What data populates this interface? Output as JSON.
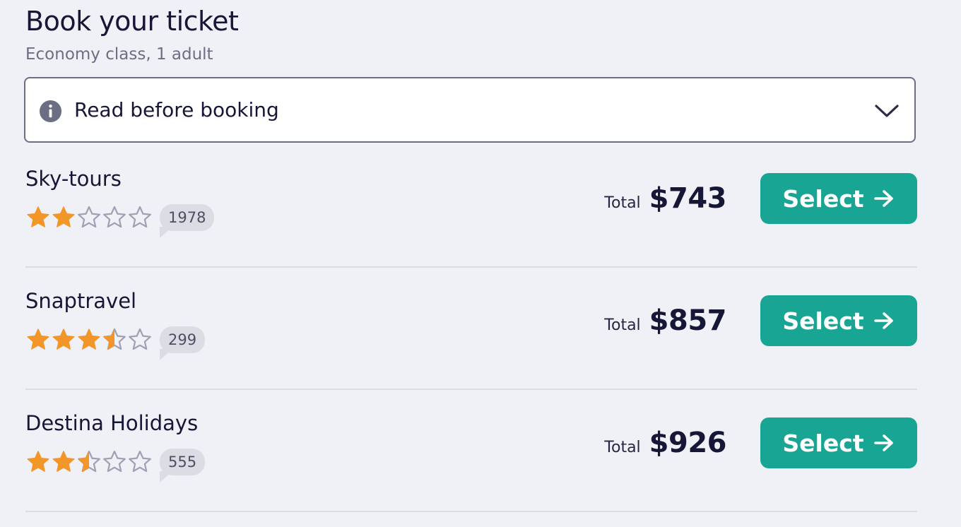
{
  "page": {
    "title": "Book your ticket",
    "subtitle": "Economy class, 1 adult"
  },
  "notice": {
    "label": "Read before booking",
    "icon": "info-icon",
    "toggle_icon": "chevron-down-icon"
  },
  "colors": {
    "accent": "#19a593",
    "star_filled": "#f39629",
    "star_empty": "#9ea1b3",
    "text_primary": "#161637",
    "background": "#f0f1f6"
  },
  "offers": [
    {
      "agency": "Sky-tours",
      "rating": 2,
      "review_count": "1978",
      "total_label": "Total",
      "price": "$743",
      "select_label": "Select"
    },
    {
      "agency": "Snaptravel",
      "rating": 3.5,
      "review_count": "299",
      "total_label": "Total",
      "price": "$857",
      "select_label": "Select"
    },
    {
      "agency": "Destina Holidays",
      "rating": 2.5,
      "review_count": "555",
      "total_label": "Total",
      "price": "$926",
      "select_label": "Select"
    }
  ]
}
